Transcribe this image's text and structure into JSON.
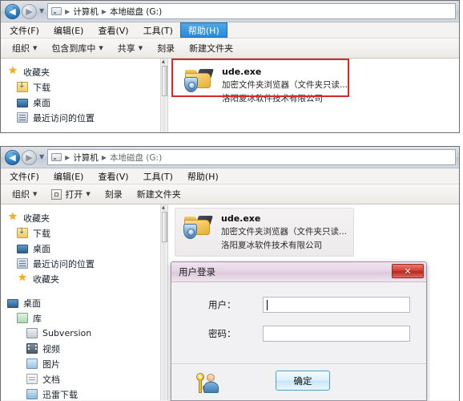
{
  "windows": {
    "top": {
      "address": {
        "drive_icon": "drive-icon",
        "crumbs": [
          "计算机",
          "本地磁盘 (G:)"
        ]
      },
      "menu": [
        "文件(F)",
        "编辑(E)",
        "查看(V)",
        "工具(T)",
        "帮助(H)"
      ],
      "menu_active": "帮助(H)",
      "toolbar": [
        "组织 ▾",
        "包含到库中 ▾",
        "共享 ▾",
        "刻录",
        "新建文件夹"
      ],
      "toolbar_items": [
        {
          "label": "组织",
          "caret": "▾"
        },
        {
          "label": "包含到库中",
          "caret": "▾"
        },
        {
          "label": "共享",
          "caret": "▾"
        },
        {
          "label": "刻录",
          "caret": ""
        },
        {
          "label": "新建文件夹",
          "caret": ""
        }
      ],
      "nav_items": [
        {
          "label": "收藏夹",
          "icon": "star-icon",
          "indent": 0
        },
        {
          "label": "下载",
          "icon": "download-icon",
          "indent": 1
        },
        {
          "label": "桌面",
          "icon": "desktop-icon",
          "indent": 1
        },
        {
          "label": "最近访问的位置",
          "icon": "recent-places-icon",
          "indent": 1
        }
      ],
      "file": {
        "name": "ude.exe",
        "description": "加密文件夹浏览器（文件夹只读...",
        "company": "洛阳夏冰软件技术有限公司",
        "icon": "locked-folder-icon"
      },
      "annotation_color": "#d42a2a"
    },
    "bottom": {
      "address": {
        "drive_icon": "drive-icon",
        "crumbs": [
          "计算机",
          "本地磁盘 (G:)"
        ]
      },
      "menu": [
        "文件(F)",
        "编辑(E)",
        "查看(V)",
        "工具(T)",
        "帮助(H)"
      ],
      "menu_active": "",
      "toolbar_items": [
        {
          "label": "组织",
          "caret": "▾"
        },
        {
          "label": "打开",
          "caret": "▾"
        },
        {
          "label": "刻录",
          "caret": ""
        },
        {
          "label": "新建文件夹",
          "caret": ""
        }
      ],
      "nav_items": [
        {
          "label": "收藏夹",
          "icon": "star-icon",
          "indent": 0
        },
        {
          "label": "下载",
          "icon": "download-icon",
          "indent": 1
        },
        {
          "label": "桌面",
          "icon": "desktop-icon",
          "indent": 1
        },
        {
          "label": "最近访问的位置",
          "icon": "recent-places-icon",
          "indent": 1
        },
        {
          "label": "收藏夹",
          "icon": "star-icon",
          "indent": 1
        },
        {
          "label": "桌面",
          "icon": "desktop-icon",
          "indent": 0
        },
        {
          "label": "库",
          "icon": "library-icon",
          "indent": 1
        },
        {
          "label": "Subversion",
          "icon": "subversion-icon",
          "indent": 2
        },
        {
          "label": "视频",
          "icon": "video-icon",
          "indent": 2
        },
        {
          "label": "图片",
          "icon": "pictures-icon",
          "indent": 2
        },
        {
          "label": "文档",
          "icon": "documents-icon",
          "indent": 2
        },
        {
          "label": "迅雷下载",
          "icon": "thunder-download-icon",
          "indent": 2
        }
      ],
      "file": {
        "name": "ude.exe",
        "description": "加密文件夹浏览器（文件夹只读...",
        "company": "洛阳夏冰软件技术有限公司",
        "icon": "locked-folder-icon"
      }
    }
  },
  "dialog": {
    "title": "用户登录",
    "close_label": "✕",
    "fields": [
      {
        "label": "用户：",
        "value": "",
        "focused": true
      },
      {
        "label": "密码：",
        "value": "",
        "focused": false
      }
    ],
    "icon": "key-user-icon",
    "ok_label": "确定"
  }
}
